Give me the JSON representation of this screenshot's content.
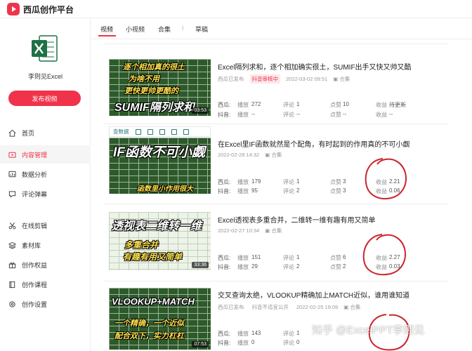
{
  "app": {
    "name": "西瓜创作平台"
  },
  "account": {
    "name": "李则见Excel"
  },
  "publish_label": "发布视频",
  "nav": [
    {
      "label": "首页",
      "icon": "home-icon"
    },
    {
      "label": "内容管理",
      "icon": "video-icon",
      "active": true
    },
    {
      "label": "数据分析",
      "icon": "chart-icon"
    },
    {
      "label": "评论弹幕",
      "icon": "comment-icon"
    },
    {
      "label": "在线剪辑",
      "icon": "scissors-icon"
    },
    {
      "label": "素材库",
      "icon": "layers-icon"
    },
    {
      "label": "创作权益",
      "icon": "gift-icon"
    },
    {
      "label": "创作课程",
      "icon": "book-icon"
    },
    {
      "label": "创作设置",
      "icon": "gear-icon"
    }
  ],
  "tabs": [
    "视频",
    "小视频",
    "合集",
    "I",
    "草稿"
  ],
  "hover_bar": [
    "查数据",
    "",
    "",
    "",
    "",
    ""
  ],
  "labels": {
    "xigua": "西瓜:",
    "douyin": "抖音:",
    "play": "播放",
    "comment": "评论",
    "like": "点赞",
    "income": "收益",
    "collection": "合集"
  },
  "videos": [
    {
      "title": "Excel隔列求和，逐个相加确实很土，SUMIF出手又快又帅又酷",
      "source": "西瓜已发布",
      "badge": "抖音审核中",
      "date": "2022-03-02 09:51",
      "thumb_lines": [
        "逐个相加真的很土",
        "为啥不用",
        "更快更帅更酷的",
        "SUMIF隔列求和"
      ],
      "duration": "03:53",
      "xigua": {
        "play": "272",
        "comment": "1",
        "like": "10",
        "income": "待更新"
      },
      "douyin": {
        "play": "--",
        "comment": "--",
        "like": "--",
        "income": "--"
      }
    },
    {
      "title": "在Excel里IF函数就然是个配角，有时起到的作用真的不可小觑",
      "source": "",
      "badge": "",
      "date": "2022-02-28 14:32",
      "thumb_lines": [
        "IF函数不可小觑",
        "函数里小作用很大"
      ],
      "duration": "",
      "xigua": {
        "play": "179",
        "comment": "1",
        "like": "3",
        "income": "2.21"
      },
      "douyin": {
        "play": "95",
        "comment": "2",
        "like": "3",
        "income": "0.06"
      }
    },
    {
      "title": "Excel透视表多重合并，二维转一维有趣有用又简单",
      "source": "",
      "badge": "",
      "date": "2022-02-27 10:34",
      "thumb_lines": [
        "透视表二维转一维",
        "多重合并",
        "有趣有用又简单"
      ],
      "duration": "33:36",
      "xigua": {
        "play": "151",
        "comment": "1",
        "like": "6",
        "income": "2.27"
      },
      "douyin": {
        "play": "29",
        "comment": "2",
        "like": "2",
        "income": "0.03"
      }
    },
    {
      "title": "交叉查询太绝，VLOOKUP精确加上MATCH近似，谁用谁知道",
      "source": "西瓜已发布",
      "badge": "抖音不适宜公开",
      "date": "2022-02-25 19:09",
      "thumb_lines": [
        "VLOOKUP+MATCH",
        "一个精确，一个近似",
        "配合双下，实力杠杠"
      ],
      "duration": "07:53",
      "xigua": {
        "play": "143",
        "comment": "1",
        "like": "",
        "income": ""
      },
      "douyin": {
        "play": "0",
        "comment": "0",
        "like": "",
        "income": ""
      }
    }
  ],
  "watermark": "知乎 @ExcelPPT李则见",
  "colors": {
    "accent": "#f0334b",
    "excel_green": "#1e7145"
  }
}
